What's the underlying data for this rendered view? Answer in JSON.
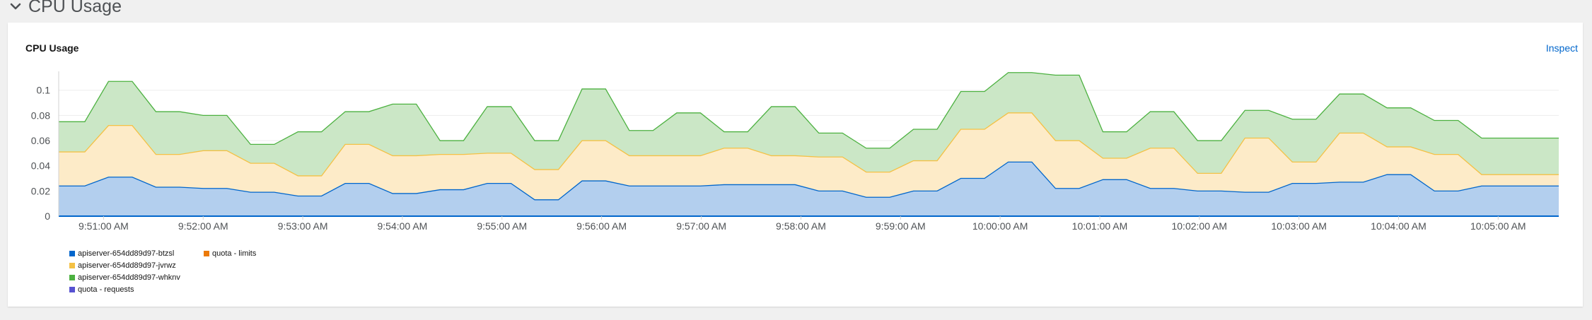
{
  "section": {
    "title": "CPU Usage"
  },
  "card": {
    "title": "CPU Usage",
    "inspect_label": "Inspect"
  },
  "chart_data": {
    "type": "area",
    "stacked": true,
    "title": "CPU Usage",
    "xlabel": "",
    "ylabel": "",
    "ylim": [
      0,
      0.115
    ],
    "y_ticks": [
      0,
      0.02,
      0.04,
      0.06,
      0.08,
      0.1
    ],
    "y_tick_labels": [
      "0",
      "0.02",
      "0.04",
      "0.06",
      "0.08",
      "0.1"
    ],
    "x_range": [
      0,
      100
    ],
    "x_ticks": [
      {
        "x": 2.99,
        "label": "9:51:00 AM"
      },
      {
        "x": 9.63,
        "label": "9:52:00 AM"
      },
      {
        "x": 16.27,
        "label": "9:53:00 AM"
      },
      {
        "x": 22.91,
        "label": "9:54:00 AM"
      },
      {
        "x": 29.55,
        "label": "9:55:00 AM"
      },
      {
        "x": 36.19,
        "label": "9:56:00 AM"
      },
      {
        "x": 42.84,
        "label": "9:57:00 AM"
      },
      {
        "x": 49.48,
        "label": "9:58:00 AM"
      },
      {
        "x": 56.12,
        "label": "9:59:00 AM"
      },
      {
        "x": 62.76,
        "label": "10:00:00 AM"
      },
      {
        "x": 69.4,
        "label": "10:01:00 AM"
      },
      {
        "x": 76.04,
        "label": "10:02:00 AM"
      },
      {
        "x": 82.68,
        "label": "10:03:00 AM"
      },
      {
        "x": 89.32,
        "label": "10:04:00 AM"
      },
      {
        "x": 95.96,
        "label": "10:05:00 AM"
      }
    ],
    "x": [
      0,
      1.74,
      3.32,
      4.9,
      6.48,
      8.05,
      9.63,
      11.21,
      12.79,
      14.37,
      15.95,
      17.52,
      19.1,
      20.68,
      22.26,
      23.84,
      25.42,
      26.99,
      28.57,
      30.15,
      31.73,
      33.31,
      34.89,
      36.46,
      38.04,
      39.62,
      41.2,
      42.78,
      44.36,
      45.93,
      47.51,
      49.09,
      50.67,
      52.25,
      53.83,
      55.4,
      56.98,
      58.56,
      60.14,
      61.72,
      63.3,
      64.87,
      66.45,
      68.03,
      69.61,
      71.19,
      72.77,
      74.34,
      75.92,
      77.5,
      79.08,
      80.66,
      82.24,
      83.82,
      85.39,
      86.97,
      88.55,
      90.13,
      91.71,
      93.29,
      94.86,
      96.44,
      98.02,
      100
    ],
    "series": [
      {
        "name": "apiserver-654dd89d97-btzsl",
        "color": "#0066cc",
        "fill": "#b3cfee",
        "values": [
          0.024,
          0.024,
          0.031,
          0.031,
          0.023,
          0.023,
          0.022,
          0.022,
          0.019,
          0.019,
          0.016,
          0.016,
          0.026,
          0.026,
          0.018,
          0.018,
          0.021,
          0.021,
          0.026,
          0.026,
          0.013,
          0.013,
          0.028,
          0.028,
          0.024,
          0.024,
          0.024,
          0.024,
          0.025,
          0.025,
          0.025,
          0.025,
          0.02,
          0.02,
          0.015,
          0.015,
          0.02,
          0.02,
          0.03,
          0.03,
          0.043,
          0.043,
          0.022,
          0.022,
          0.029,
          0.029,
          0.022,
          0.022,
          0.02,
          0.02,
          0.019,
          0.019,
          0.026,
          0.026,
          0.027,
          0.027,
          0.033,
          0.033,
          0.02,
          0.02,
          0.024,
          0.024,
          0.024,
          0.024
        ]
      },
      {
        "name": "apiserver-654dd89d97-jvrwz",
        "color": "#f4c145",
        "fill": "#fdebc8",
        "values": [
          0.027,
          0.027,
          0.041,
          0.041,
          0.026,
          0.026,
          0.03,
          0.03,
          0.023,
          0.023,
          0.016,
          0.016,
          0.031,
          0.031,
          0.03,
          0.03,
          0.028,
          0.028,
          0.024,
          0.024,
          0.024,
          0.024,
          0.032,
          0.032,
          0.024,
          0.024,
          0.024,
          0.024,
          0.029,
          0.029,
          0.023,
          0.023,
          0.027,
          0.027,
          0.02,
          0.02,
          0.024,
          0.024,
          0.039,
          0.039,
          0.039,
          0.039,
          0.038,
          0.038,
          0.017,
          0.017,
          0.032,
          0.032,
          0.014,
          0.014,
          0.043,
          0.043,
          0.017,
          0.017,
          0.039,
          0.039,
          0.022,
          0.022,
          0.029,
          0.029,
          0.009,
          0.009,
          0.009,
          0.009
        ]
      },
      {
        "name": "apiserver-654dd89d97-whknv",
        "color": "#4cb140",
        "fill": "#cbe7c6",
        "values": [
          0.024,
          0.024,
          0.035,
          0.035,
          0.034,
          0.034,
          0.028,
          0.028,
          0.015,
          0.015,
          0.035,
          0.035,
          0.026,
          0.026,
          0.041,
          0.041,
          0.011,
          0.011,
          0.037,
          0.037,
          0.023,
          0.023,
          0.041,
          0.041,
          0.02,
          0.02,
          0.034,
          0.034,
          0.013,
          0.013,
          0.039,
          0.039,
          0.019,
          0.019,
          0.019,
          0.019,
          0.025,
          0.025,
          0.03,
          0.03,
          0.032,
          0.032,
          0.052,
          0.052,
          0.021,
          0.021,
          0.029,
          0.029,
          0.026,
          0.026,
          0.022,
          0.022,
          0.034,
          0.034,
          0.031,
          0.031,
          0.031,
          0.031,
          0.027,
          0.027,
          0.029,
          0.029,
          0.029,
          0.029
        ]
      }
    ],
    "legend": {
      "placement": "bottom-left",
      "items": [
        {
          "name": "apiserver-654dd89d97-btzsl",
          "color": "#0066cc"
        },
        {
          "name": "quota - limits",
          "color": "#ec7a08"
        },
        {
          "name": "apiserver-654dd89d97-jvrwz",
          "color": "#f4c145"
        },
        {
          "name": "apiserver-654dd89d97-whknv",
          "color": "#4cb140"
        },
        {
          "name": "quota - requests",
          "color": "#5752d1"
        }
      ]
    },
    "grid": {
      "horizontal": true,
      "vertical": false
    },
    "axis_color": "#d2d2d2",
    "tick_text_color": "#4f5255"
  }
}
